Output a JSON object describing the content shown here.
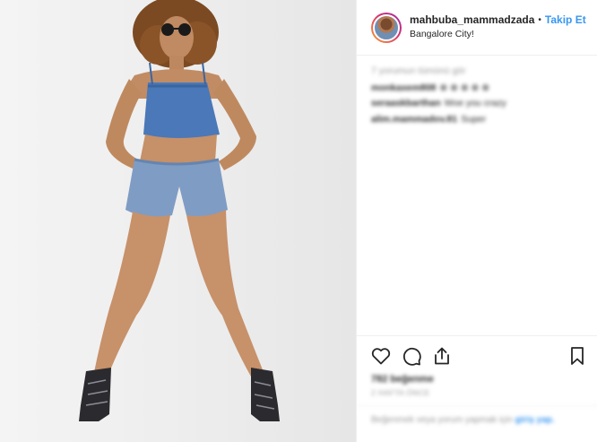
{
  "header": {
    "username": "mahbuba_mammadzada",
    "separator": "•",
    "follow_label": "Takip Et",
    "location": "Bangalore City!"
  },
  "comments": {
    "see_all": "7 yorumun tümünü gör",
    "items": [
      {
        "user": "monkaxem808",
        "text": "⊗ ⊕ ⊗ ⊕ ⊗"
      },
      {
        "user": "seraaskbarthan",
        "text": "Woe you crazy"
      },
      {
        "user": "alim.mammadov.81",
        "text": "Super"
      }
    ]
  },
  "actions": {
    "likes": "782 beğenme",
    "time": "2 HAFTA ÖNCE"
  },
  "add_comment": {
    "placeholder": "Beğenmek veya yorum yapmak için",
    "login": "giriş",
    "suffix": "yap."
  },
  "icons": [
    "heart-icon",
    "comment-icon",
    "share-icon",
    "bookmark-icon"
  ]
}
